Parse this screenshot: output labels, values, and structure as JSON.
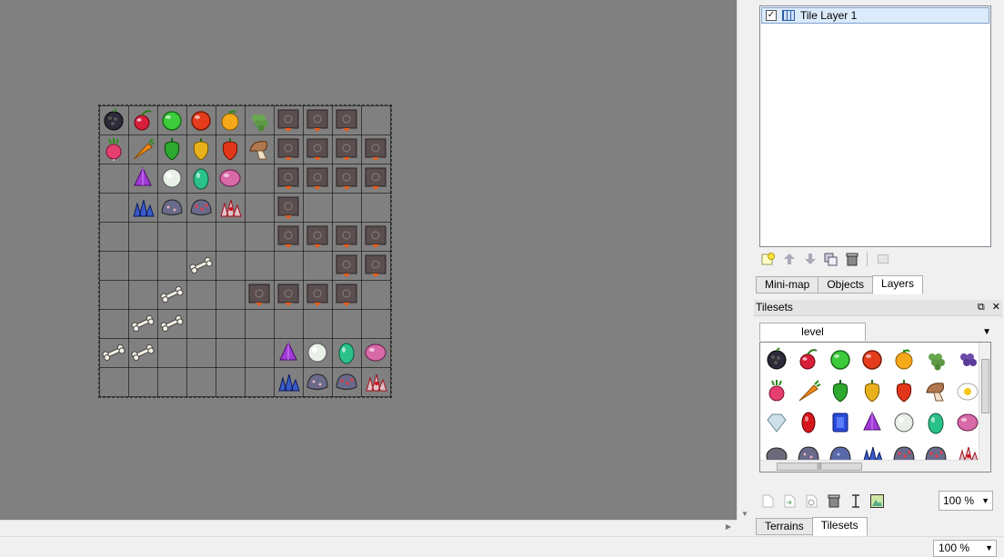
{
  "layers": {
    "items": [
      {
        "label": "Tile Layer 1",
        "checked": "✓"
      }
    ]
  },
  "dock_tabs": [
    {
      "label": "Mini-map"
    },
    {
      "label": "Objects"
    },
    {
      "label": "Layers"
    }
  ],
  "tilesets_panel": {
    "title": "Tilesets",
    "tileset_tab": "level",
    "zoom": "100 %"
  },
  "bottom_tabs": [
    {
      "label": "Terrains"
    },
    {
      "label": "Tilesets"
    }
  ],
  "statusbar": {
    "zoom": "100 %"
  },
  "map_tiles": [
    [
      "blackberry",
      "cherry",
      "green-apple",
      "red-apple",
      "orange",
      "grapes",
      "crate",
      "crate",
      "crate",
      "empty"
    ],
    [
      "radish",
      "carrot",
      "green-pepper",
      "yellow-pepper",
      "red-pepper",
      "mushroom",
      "crate",
      "crate",
      "crate",
      "crate"
    ],
    [
      "empty",
      "purple-gem",
      "pearl",
      "green-egg",
      "pink-egg",
      "empty",
      "crate",
      "crate",
      "crate",
      "crate"
    ],
    [
      "empty",
      "crystal",
      "rock",
      "rock-red",
      "crystal-red",
      "empty",
      "crate",
      "empty",
      "empty",
      "empty"
    ],
    [
      "empty",
      "empty",
      "empty",
      "empty",
      "empty",
      "empty",
      "crate",
      "crate",
      "crate",
      "crate"
    ],
    [
      "empty",
      "empty",
      "empty",
      "bone",
      "empty",
      "empty",
      "empty",
      "empty",
      "crate",
      "crate"
    ],
    [
      "empty",
      "empty",
      "bone",
      "empty",
      "empty",
      "crate",
      "crate",
      "crate",
      "crate",
      "empty"
    ],
    [
      "empty",
      "bone",
      "bone",
      "empty",
      "empty",
      "empty",
      "empty",
      "empty",
      "empty",
      "empty"
    ],
    [
      "bone",
      "bone",
      "empty",
      "empty",
      "empty",
      "empty",
      "purple-gem",
      "pearl",
      "green-egg",
      "pink-egg"
    ],
    [
      "empty",
      "empty",
      "empty",
      "empty",
      "empty",
      "empty",
      "crystal",
      "rock",
      "rock-red",
      "crystal-red"
    ]
  ],
  "tileset_tiles": [
    "blackberry",
    "cherry",
    "green-apple",
    "red-apple",
    "orange",
    "grapes",
    "grape-purple",
    "radish",
    "carrot",
    "green-pepper",
    "yellow-pepper",
    "red-pepper",
    "mushroom",
    "egg-fried",
    "diamond",
    "ruby",
    "sapphire",
    "purple-gem",
    "pearl",
    "green-egg",
    "pink-egg",
    "rock-plain",
    "rock",
    "rock-blue",
    "crystal",
    "rock-red",
    "rock-red",
    "crystal-red"
  ],
  "colors": {
    "canvas_bg": "#808080",
    "selection": "#dcebfc"
  }
}
